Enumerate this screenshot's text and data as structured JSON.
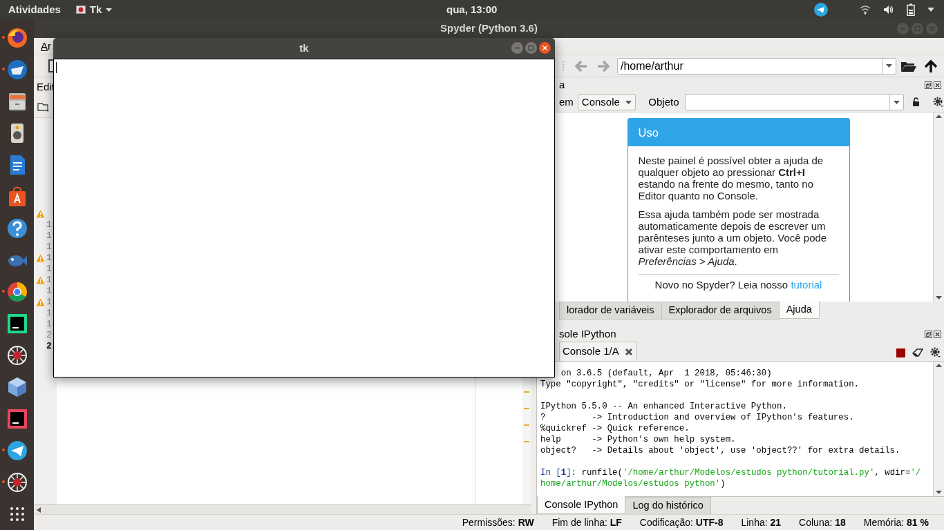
{
  "top_bar": {
    "activities": "Atividades",
    "app_menu": "Tk",
    "clock": "qua, 13:00"
  },
  "dock": [
    {
      "kind": "firefox",
      "running": true
    },
    {
      "kind": "thunderbird",
      "running": true
    },
    {
      "kind": "files",
      "running": false
    },
    {
      "kind": "speaker",
      "running": false
    },
    {
      "kind": "writer",
      "running": false
    },
    {
      "kind": "software",
      "running": false
    },
    {
      "kind": "help",
      "running": false
    },
    {
      "kind": "fish",
      "running": false
    },
    {
      "kind": "chrome",
      "running": true
    },
    {
      "kind": "pycharm",
      "running": false
    },
    {
      "kind": "spider",
      "running": false
    },
    {
      "kind": "cube",
      "running": false
    },
    {
      "kind": "intellij",
      "running": false
    },
    {
      "kind": "telegram",
      "running": true
    },
    {
      "kind": "spider",
      "running": true
    },
    {
      "kind": "grid",
      "running": false
    }
  ],
  "spyder": {
    "title": "Spyder (Python 3.6)",
    "menu": "Ar",
    "path": "/home/arthur"
  },
  "editor": {
    "pane_title": "Edit",
    "lines": [
      {
        "warning": true
      },
      {
        "text": "1",
        "warning": false,
        "current": false
      },
      {
        "text": "1",
        "warning": false,
        "current": false
      },
      {
        "text": "1",
        "warning": false,
        "current": false
      },
      {
        "text": "1",
        "warning": true,
        "current": false
      },
      {
        "text": "1",
        "warning": false,
        "current": false
      },
      {
        "text": "1",
        "warning": true,
        "current": false
      },
      {
        "text": "1",
        "warning": false,
        "current": false
      },
      {
        "text": "1",
        "warning": true,
        "current": false
      },
      {
        "text": "1",
        "warning": false,
        "current": false
      },
      {
        "text": "1",
        "warning": false,
        "current": false
      },
      {
        "text": "2",
        "warning": false,
        "current": false
      },
      {
        "text": "2",
        "warning": false,
        "current": true
      }
    ]
  },
  "help": {
    "pane_title": "a",
    "source_label": "em",
    "source": "Console",
    "object_label": "Objeto",
    "card": {
      "title": "Uso",
      "paragraphs": [
        "Neste painel é possível obter a ajuda de qualquer objeto ao pressionar **Ctrl+I** estando na frente do mesmo, tanto no Editor quanto no Console.",
        "Essa ajuda também pode ser mostrada automaticamente depois de escrever um parênteses junto a um objeto. Você pode ativar este comportamento em *Preferências > Ajuda*."
      ],
      "footer": "Novo no Spyder? Leia nosso",
      "footer_link": "tutorial"
    },
    "tabs": [
      {
        "label": "lorador de variáveis",
        "selected": false
      },
      {
        "label": "Explorador de arquivos",
        "selected": false
      },
      {
        "label": "Ajuda",
        "selected": true
      }
    ]
  },
  "console": {
    "pane_title": "sole IPython",
    "tab": "Console 1/A",
    "lines": [
      {
        "kind": "cut",
        "text": "on 3.6.5 (default, Apr  1 2018, 05:46:30)"
      },
      {
        "kind": "output",
        "text": "Type \"copyright\", \"credits\" or \"license\" for more information."
      },
      {
        "kind": "blank"
      },
      {
        "kind": "output",
        "text": "IPython 5.5.0 -- An enhanced Interactive Python."
      },
      {
        "kind": "output",
        "text": "?         -> Introduction and overview of IPython's features."
      },
      {
        "kind": "output",
        "text": "%quickref -> Quick reference."
      },
      {
        "kind": "output",
        "text": "help      -> Python's own help system."
      },
      {
        "kind": "output",
        "text": "object?   -> Details about 'object', use 'object??' for extra details."
      },
      {
        "kind": "blank"
      },
      {
        "kind": "input",
        "parts": [
          {
            "kind": "prompt",
            "text": "In ["
          },
          {
            "kind": "number",
            "text": "1"
          },
          {
            "kind": "prompt",
            "text": "]: "
          },
          {
            "kind": "code",
            "text": "runfile("
          },
          {
            "kind": "string",
            "text": "'/home/arthur/Modelos/estudos python/tutorial.py'"
          },
          {
            "kind": "code",
            "text": ", wdir="
          },
          {
            "kind": "string",
            "text": "'/"
          }
        ]
      },
      {
        "kind": "input",
        "parts": [
          {
            "kind": "string",
            "text": "home/arthur/Modelos/estudos python'"
          },
          {
            "kind": "code",
            "text": ")"
          }
        ]
      }
    ],
    "tabs": [
      {
        "label": "Console IPython",
        "selected": true
      },
      {
        "label": "Log do histórico",
        "selected": false
      }
    ]
  },
  "status_bar": [
    {
      "label": "Permissões:",
      "value": "RW"
    },
    {
      "label": "Fim de linha:",
      "value": "LF"
    },
    {
      "label": "Codificação:",
      "value": "UTF-8"
    },
    {
      "label": "Linha:",
      "value": "21"
    },
    {
      "label": "Coluna:",
      "value": "18"
    },
    {
      "label": "Memória:",
      "value": "81 %"
    }
  ],
  "tk_window": {
    "title": "tk"
  }
}
